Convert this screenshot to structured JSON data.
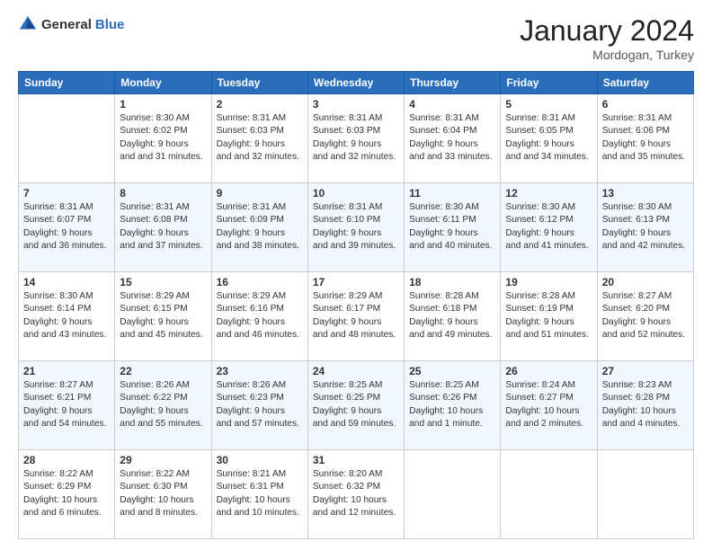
{
  "header": {
    "logo_general": "General",
    "logo_blue": "Blue",
    "month_year": "January 2024",
    "location": "Mordogan, Turkey"
  },
  "days_of_week": [
    "Sunday",
    "Monday",
    "Tuesday",
    "Wednesday",
    "Thursday",
    "Friday",
    "Saturday"
  ],
  "weeks": [
    [
      {
        "day": "",
        "sunrise": "",
        "sunset": "",
        "daylight": "",
        "empty": true
      },
      {
        "day": "1",
        "sunrise": "Sunrise: 8:30 AM",
        "sunset": "Sunset: 6:02 PM",
        "daylight": "Daylight: 9 hours and 31 minutes."
      },
      {
        "day": "2",
        "sunrise": "Sunrise: 8:31 AM",
        "sunset": "Sunset: 6:03 PM",
        "daylight": "Daylight: 9 hours and 32 minutes."
      },
      {
        "day": "3",
        "sunrise": "Sunrise: 8:31 AM",
        "sunset": "Sunset: 6:03 PM",
        "daylight": "Daylight: 9 hours and 32 minutes."
      },
      {
        "day": "4",
        "sunrise": "Sunrise: 8:31 AM",
        "sunset": "Sunset: 6:04 PM",
        "daylight": "Daylight: 9 hours and 33 minutes."
      },
      {
        "day": "5",
        "sunrise": "Sunrise: 8:31 AM",
        "sunset": "Sunset: 6:05 PM",
        "daylight": "Daylight: 9 hours and 34 minutes."
      },
      {
        "day": "6",
        "sunrise": "Sunrise: 8:31 AM",
        "sunset": "Sunset: 6:06 PM",
        "daylight": "Daylight: 9 hours and 35 minutes."
      }
    ],
    [
      {
        "day": "7",
        "sunrise": "Sunrise: 8:31 AM",
        "sunset": "Sunset: 6:07 PM",
        "daylight": "Daylight: 9 hours and 36 minutes."
      },
      {
        "day": "8",
        "sunrise": "Sunrise: 8:31 AM",
        "sunset": "Sunset: 6:08 PM",
        "daylight": "Daylight: 9 hours and 37 minutes."
      },
      {
        "day": "9",
        "sunrise": "Sunrise: 8:31 AM",
        "sunset": "Sunset: 6:09 PM",
        "daylight": "Daylight: 9 hours and 38 minutes."
      },
      {
        "day": "10",
        "sunrise": "Sunrise: 8:31 AM",
        "sunset": "Sunset: 6:10 PM",
        "daylight": "Daylight: 9 hours and 39 minutes."
      },
      {
        "day": "11",
        "sunrise": "Sunrise: 8:30 AM",
        "sunset": "Sunset: 6:11 PM",
        "daylight": "Daylight: 9 hours and 40 minutes."
      },
      {
        "day": "12",
        "sunrise": "Sunrise: 8:30 AM",
        "sunset": "Sunset: 6:12 PM",
        "daylight": "Daylight: 9 hours and 41 minutes."
      },
      {
        "day": "13",
        "sunrise": "Sunrise: 8:30 AM",
        "sunset": "Sunset: 6:13 PM",
        "daylight": "Daylight: 9 hours and 42 minutes."
      }
    ],
    [
      {
        "day": "14",
        "sunrise": "Sunrise: 8:30 AM",
        "sunset": "Sunset: 6:14 PM",
        "daylight": "Daylight: 9 hours and 43 minutes."
      },
      {
        "day": "15",
        "sunrise": "Sunrise: 8:29 AM",
        "sunset": "Sunset: 6:15 PM",
        "daylight": "Daylight: 9 hours and 45 minutes."
      },
      {
        "day": "16",
        "sunrise": "Sunrise: 8:29 AM",
        "sunset": "Sunset: 6:16 PM",
        "daylight": "Daylight: 9 hours and 46 minutes."
      },
      {
        "day": "17",
        "sunrise": "Sunrise: 8:29 AM",
        "sunset": "Sunset: 6:17 PM",
        "daylight": "Daylight: 9 hours and 48 minutes."
      },
      {
        "day": "18",
        "sunrise": "Sunrise: 8:28 AM",
        "sunset": "Sunset: 6:18 PM",
        "daylight": "Daylight: 9 hours and 49 minutes."
      },
      {
        "day": "19",
        "sunrise": "Sunrise: 8:28 AM",
        "sunset": "Sunset: 6:19 PM",
        "daylight": "Daylight: 9 hours and 51 minutes."
      },
      {
        "day": "20",
        "sunrise": "Sunrise: 8:27 AM",
        "sunset": "Sunset: 6:20 PM",
        "daylight": "Daylight: 9 hours and 52 minutes."
      }
    ],
    [
      {
        "day": "21",
        "sunrise": "Sunrise: 8:27 AM",
        "sunset": "Sunset: 6:21 PM",
        "daylight": "Daylight: 9 hours and 54 minutes."
      },
      {
        "day": "22",
        "sunrise": "Sunrise: 8:26 AM",
        "sunset": "Sunset: 6:22 PM",
        "daylight": "Daylight: 9 hours and 55 minutes."
      },
      {
        "day": "23",
        "sunrise": "Sunrise: 8:26 AM",
        "sunset": "Sunset: 6:23 PM",
        "daylight": "Daylight: 9 hours and 57 minutes."
      },
      {
        "day": "24",
        "sunrise": "Sunrise: 8:25 AM",
        "sunset": "Sunset: 6:25 PM",
        "daylight": "Daylight: 9 hours and 59 minutes."
      },
      {
        "day": "25",
        "sunrise": "Sunrise: 8:25 AM",
        "sunset": "Sunset: 6:26 PM",
        "daylight": "Daylight: 10 hours and 1 minute."
      },
      {
        "day": "26",
        "sunrise": "Sunrise: 8:24 AM",
        "sunset": "Sunset: 6:27 PM",
        "daylight": "Daylight: 10 hours and 2 minutes."
      },
      {
        "day": "27",
        "sunrise": "Sunrise: 8:23 AM",
        "sunset": "Sunset: 6:28 PM",
        "daylight": "Daylight: 10 hours and 4 minutes."
      }
    ],
    [
      {
        "day": "28",
        "sunrise": "Sunrise: 8:22 AM",
        "sunset": "Sunset: 6:29 PM",
        "daylight": "Daylight: 10 hours and 6 minutes."
      },
      {
        "day": "29",
        "sunrise": "Sunrise: 8:22 AM",
        "sunset": "Sunset: 6:30 PM",
        "daylight": "Daylight: 10 hours and 8 minutes."
      },
      {
        "day": "30",
        "sunrise": "Sunrise: 8:21 AM",
        "sunset": "Sunset: 6:31 PM",
        "daylight": "Daylight: 10 hours and 10 minutes."
      },
      {
        "day": "31",
        "sunrise": "Sunrise: 8:20 AM",
        "sunset": "Sunset: 6:32 PM",
        "daylight": "Daylight: 10 hours and 12 minutes."
      },
      {
        "day": "",
        "sunrise": "",
        "sunset": "",
        "daylight": "",
        "empty": true
      },
      {
        "day": "",
        "sunrise": "",
        "sunset": "",
        "daylight": "",
        "empty": true
      },
      {
        "day": "",
        "sunrise": "",
        "sunset": "",
        "daylight": "",
        "empty": true
      }
    ]
  ]
}
